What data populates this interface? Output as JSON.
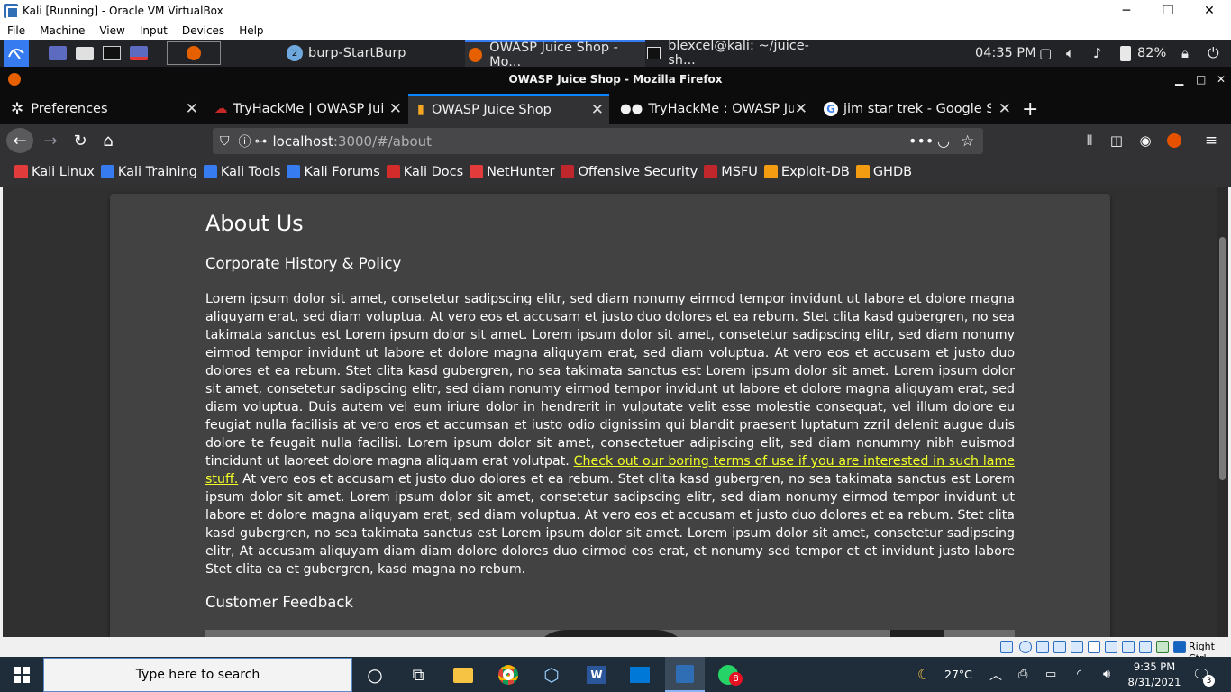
{
  "vbox": {
    "title": "Kali [Running] - Oracle VM VirtualBox",
    "menu": [
      "File",
      "Machine",
      "View",
      "Input",
      "Devices",
      "Help"
    ],
    "status_right": "Right Ctrl"
  },
  "kali_panel": {
    "tasks": [
      {
        "label": "burp-StartBurp",
        "active": false
      },
      {
        "label": "OWASP Juice Shop - Mo...",
        "active": true
      },
      {
        "label": "blexcel@kali: ~/juice-sh...",
        "active": false
      }
    ],
    "clock": "04:35 PM",
    "battery": "82%",
    "task_badge": "2"
  },
  "firefox": {
    "window_title": "OWASP Juice Shop - Mozilla Firefox",
    "tabs": [
      {
        "label": "Preferences",
        "active": false
      },
      {
        "label": "TryHackMe | OWASP Juice Shop",
        "active": false
      },
      {
        "label": "OWASP Juice Shop",
        "active": true
      },
      {
        "label": "TryHackMe : OWASP Juice Shop",
        "active": false
      },
      {
        "label": "jim star trek - Google Search",
        "active": false
      }
    ],
    "url_host": "localhost",
    "url_rest": ":3000/#/about",
    "bookmarks": [
      {
        "label": "Kali Linux",
        "color": "#e23b3b"
      },
      {
        "label": "Kali Training",
        "color": "#367bf0"
      },
      {
        "label": "Kali Tools",
        "color": "#367bf0"
      },
      {
        "label": "Kali Forums",
        "color": "#367bf0"
      },
      {
        "label": "Kali Docs",
        "color": "#d42b2b"
      },
      {
        "label": "NetHunter",
        "color": "#e23b3b"
      },
      {
        "label": "Offensive Security",
        "color": "#c0272d"
      },
      {
        "label": "MSFU",
        "color": "#c0272d"
      },
      {
        "label": "Exploit-DB",
        "color": "#f39c12"
      },
      {
        "label": "GHDB",
        "color": "#f39c12"
      }
    ]
  },
  "page": {
    "title": "About Us",
    "history_heading": "Corporate History & Policy",
    "lorem_before": "Lorem ipsum dolor sit amet, consetetur sadipscing elitr, sed diam nonumy eirmod tempor invidunt ut labore et dolore magna aliquyam erat, sed diam voluptua. At vero eos et accusam et justo duo dolores et ea rebum. Stet clita kasd gubergren, no sea takimata sanctus est Lorem ipsum dolor sit amet. Lorem ipsum dolor sit amet, consetetur sadipscing elitr, sed diam nonumy eirmod tempor invidunt ut labore et dolore magna aliquyam erat, sed diam voluptua. At vero eos et accusam et justo duo dolores et ea rebum. Stet clita kasd gubergren, no sea takimata sanctus est Lorem ipsum dolor sit amet. Lorem ipsum dolor sit amet, consetetur sadipscing elitr, sed diam nonumy eirmod tempor invidunt ut labore et dolore magna aliquyam erat, sed diam voluptua. Duis autem vel eum iriure dolor in hendrerit in vulputate velit esse molestie consequat, vel illum dolore eu feugiat nulla facilisis at vero eros et accumsan et iusto odio dignissim qui blandit praesent luptatum zzril delenit augue duis dolore te feugait nulla facilisi. Lorem ipsum dolor sit amet, consectetuer adipiscing elit, sed diam nonummy nibh euismod tincidunt ut laoreet dolore magna aliquam erat volutpat. ",
    "terms_link": "Check out our boring terms of use if you are interested in such lame stuff.",
    "lorem_after": " At vero eos et accusam et justo duo dolores et ea rebum. Stet clita kasd gubergren, no sea takimata sanctus est Lorem ipsum dolor sit amet. Lorem ipsum dolor sit amet, consetetur sadipscing elitr, sed diam nonumy eirmod tempor invidunt ut labore et dolore magna aliquyam erat, sed diam voluptua. At vero eos et accusam et justo duo dolores et ea rebum. Stet clita kasd gubergren, no sea takimata sanctus est Lorem ipsum dolor sit amet. Lorem ipsum dolor sit amet, consetetur sadipscing elitr, At accusam aliquyam diam diam dolore dolores duo eirmod eos erat, et nonumy sed tempor et et invidunt justo labore Stet clita ea et gubergren, kasd magna no rebum.",
    "feedback_heading": "Customer Feedback"
  },
  "windows": {
    "search_placeholder": "Type here to search",
    "weather": "27°C",
    "time": "9:35 PM",
    "date": "8/31/2021",
    "notification_count": "3",
    "whatsapp_badge": "8"
  }
}
